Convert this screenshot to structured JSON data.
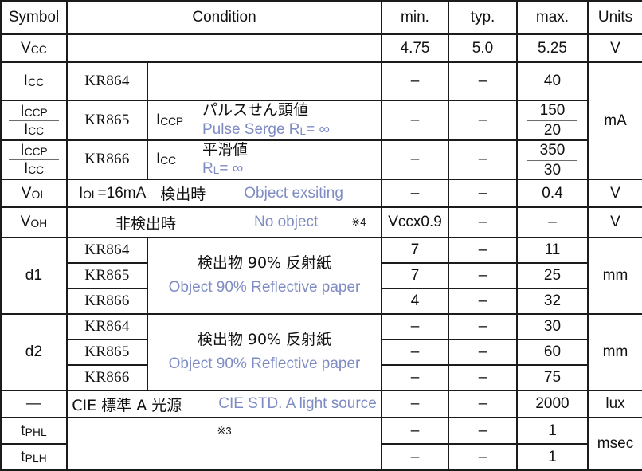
{
  "table": {
    "headers": {
      "symbol": "Symbol",
      "condition": "Condition",
      "min": "min.",
      "typ": "typ.",
      "max": "max.",
      "units": "Units"
    },
    "dash": "–",
    "rows": {
      "vcc": {
        "symbol_main": "V",
        "symbol_sub": "CC",
        "condition": "",
        "min": "4.75",
        "typ": "5.0",
        "max": "5.25",
        "units": "V"
      },
      "icc_kr864": {
        "symbol_main": "I",
        "symbol_sub": "CC",
        "model": "KR864",
        "condition": "",
        "min": "–",
        "typ": "–",
        "max": "40",
        "units": "mA"
      },
      "icc_kr865": {
        "symbol_num_main": "I",
        "symbol_num_sub": "CCP",
        "symbol_den_main": "I",
        "symbol_den_sub": "CC",
        "model": "KR865",
        "cond_label_main": "I",
        "cond_label_sub": "CCP",
        "cond_jp": "パルスせん頭値",
        "cond_en": "Pulse Serge R",
        "cond_en_sub": "L",
        "cond_en_tail": "= ∞",
        "min": "–",
        "typ": "–",
        "max_num": "150",
        "max_den": "20"
      },
      "icc_kr866": {
        "symbol_num_main": "I",
        "symbol_num_sub": "CCP",
        "symbol_den_main": "I",
        "symbol_den_sub": "CC",
        "model": "KR866",
        "cond_label_main": "I",
        "cond_label_sub": "CC",
        "cond_jp": "平滑値",
        "cond_en": "R",
        "cond_en_sub": "L",
        "cond_en_tail": "= ∞",
        "min": "–",
        "typ": "–",
        "max_num": "350",
        "max_den": "30"
      },
      "vol": {
        "symbol_main": "V",
        "symbol_sub": "OL",
        "cond_main": "I",
        "cond_sub": "OL",
        "cond_tail": "=16mA",
        "cond_jp": "検出時",
        "cond_en": "Object exsiting",
        "min": "–",
        "typ": "–",
        "max": "0.4",
        "units": "V"
      },
      "voh": {
        "symbol_main": "V",
        "symbol_sub": "OH",
        "cond_jp": "非検出時",
        "cond_en": "No object",
        "cond_note": "※4",
        "min": "Vccx0.9",
        "typ": "–",
        "max": "–",
        "units": "V"
      },
      "d1": {
        "symbol": "d1",
        "cond_jp": "検出物 90% 反射紙",
        "cond_en": "Object 90% Reflective paper",
        "units": "mm",
        "items": [
          {
            "model": "KR864",
            "min": "7",
            "typ": "–",
            "max": "11"
          },
          {
            "model": "KR865",
            "min": "7",
            "typ": "–",
            "max": "25"
          },
          {
            "model": "KR866",
            "min": "4",
            "typ": "–",
            "max": "32"
          }
        ]
      },
      "d2": {
        "symbol": "d2",
        "cond_jp": "検出物 90% 反射紙",
        "cond_en": "Object 90% Reflective paper",
        "units": "mm",
        "items": [
          {
            "model": "KR864",
            "min": "–",
            "typ": "–",
            "max": "30"
          },
          {
            "model": "KR865",
            "min": "–",
            "typ": "–",
            "max": "60"
          },
          {
            "model": "KR866",
            "min": "–",
            "typ": "–",
            "max": "75"
          }
        ]
      },
      "cie": {
        "symbol": "—",
        "cond_jp": "CIE 標準 A 光源",
        "cond_en": "CIE STD. A light source",
        "min": "–",
        "typ": "–",
        "max": "2000",
        "units": "lux"
      },
      "tphl": {
        "symbol_main": "t",
        "symbol_sub": "PHL",
        "cond_note": "※3",
        "min": "–",
        "typ": "–",
        "max": "1",
        "units": "msec"
      },
      "tplh": {
        "symbol_main": "t",
        "symbol_sub": "PLH",
        "min": "–",
        "typ": "–",
        "max": "1"
      }
    }
  },
  "colors": {
    "header_bg": "#c3c7e2",
    "english_text": "#7f8cc4",
    "border": "#1b1b1b"
  }
}
